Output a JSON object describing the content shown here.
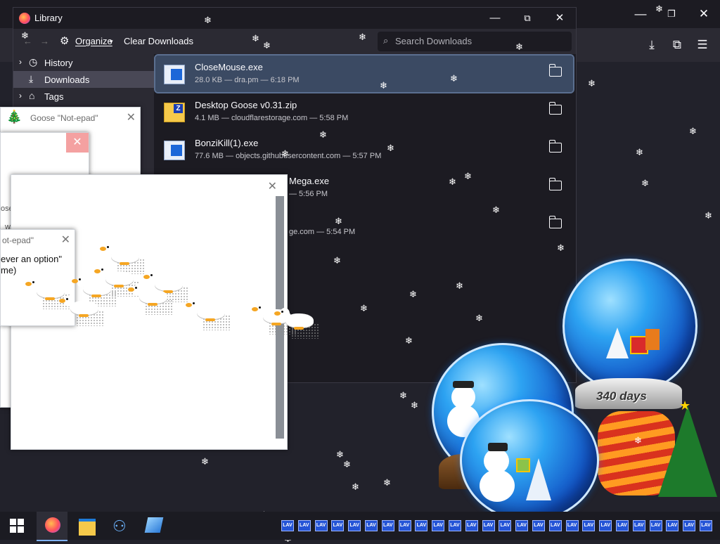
{
  "library": {
    "title": "Library",
    "toolbar": {
      "organize_label": "Organize",
      "clear_label": "Clear Downloads",
      "search_placeholder": "Search Downloads"
    },
    "sidebar": [
      {
        "label": "History",
        "icon": "clock-icon"
      },
      {
        "label": "Downloads",
        "icon": "download-icon"
      },
      {
        "label": "Tags",
        "icon": "tag-icon"
      }
    ],
    "downloads": [
      {
        "name": "CloseMouse.exe",
        "meta": "28.0 KB — dra.pm — 6:18 PM",
        "type": "exe"
      },
      {
        "name": "Desktop Goose v0.31.zip",
        "meta": "4.1 MB — cloudflarestorage.com — 5:58 PM",
        "type": "zip"
      },
      {
        "name": "BonziKill(1).exe",
        "meta": "77.6 MB — objects.githubusercontent.com — 5:57 PM",
        "type": "exe"
      },
      {
        "name": "Mega.exe",
        "meta": "— 5:56 PM",
        "type": "exe"
      },
      {
        "name": "",
        "meta": "ge.com — 5:54 PM",
        "type": "exe"
      }
    ]
  },
  "notes": {
    "small_title": "Goose \"Not-epad\"",
    "mid_title": "ot-epad\"",
    "mid_line1": "ever an option\"",
    "mid_line2": "me)",
    "cut_label": "ose",
    "cut_label2": "w"
  },
  "globes": {
    "days_label": "340 days"
  },
  "taskbar": {
    "lav_label": "LAV"
  }
}
